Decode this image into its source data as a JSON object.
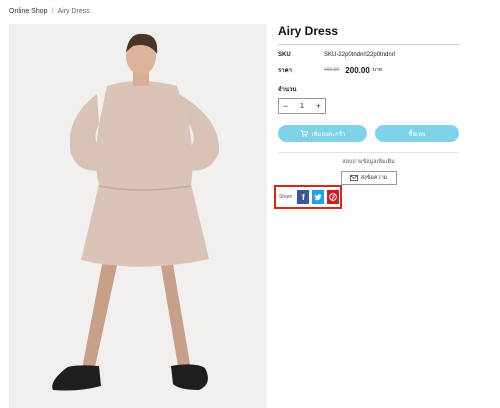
{
  "breadcrumb": {
    "shop": "Online Shop",
    "separator": "/",
    "current": "Airy Dress"
  },
  "product": {
    "title": "Airy Dress",
    "sku_label": "SKU",
    "sku_value": "SKU-22p0tndnrl22p0tndnrl",
    "price_label": "ราคา",
    "old_price": "400.00",
    "price": "200.00",
    "currency": "บาท",
    "quantity_label": "จำนวน",
    "quantity_value": "1",
    "minus": "−",
    "plus": "+"
  },
  "actions": {
    "add_to_cart": "เพิ่มลงตะกร้า",
    "buy_now": "ซื้อเลย",
    "ask_more": "สอบถามข้อมูลเพิ่มเติม",
    "message": "ส่งข้อความ"
  },
  "share": {
    "label": "Share",
    "facebook": "f",
    "twitter": "t",
    "pinterest": "p"
  },
  "colors": {
    "accent": "#7fd3e8",
    "highlight": "#d8271b",
    "facebook": "#3b5998",
    "twitter": "#1da1f2",
    "pinterest": "#cb2027"
  }
}
